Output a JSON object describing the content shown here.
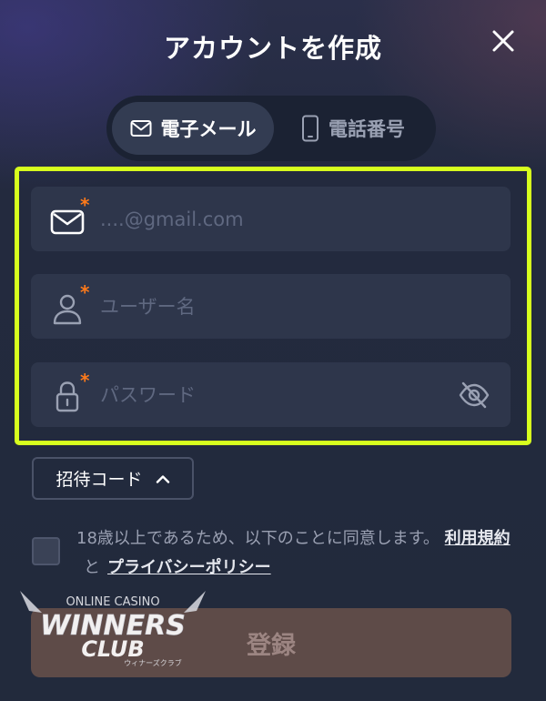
{
  "header": {
    "title": "アカウントを作成"
  },
  "tabs": [
    {
      "label": "電子メール",
      "icon": "envelope-icon",
      "active": true
    },
    {
      "label": "電話番号",
      "icon": "phone-icon",
      "active": false
    }
  ],
  "form": {
    "email": {
      "placeholder": "....@gmail.com",
      "value": "",
      "required_mark": "*"
    },
    "username": {
      "placeholder": "ユーザー名",
      "value": "",
      "required_mark": "*"
    },
    "password": {
      "placeholder": "パスワード",
      "value": "",
      "required_mark": "*"
    }
  },
  "invite": {
    "label": "招待コード"
  },
  "agreement": {
    "checked": false,
    "text": "18歳以上であるため、以下のことに同意します。",
    "terms_link": "利用規約",
    "and": "と",
    "privacy_link": "プライバシーポリシー"
  },
  "submit": {
    "label": "登録"
  },
  "watermark": {
    "top": "ONLINE CASINO",
    "main1": "WINNERS",
    "main2": "CLUB",
    "sub": "ウィナーズクラブ"
  },
  "colors": {
    "highlight": "#d7ff1e",
    "required": "#ff7a1a",
    "submit_bg": "#5e4b48",
    "field_bg": "#2e364b",
    "background": "#222a3d"
  }
}
